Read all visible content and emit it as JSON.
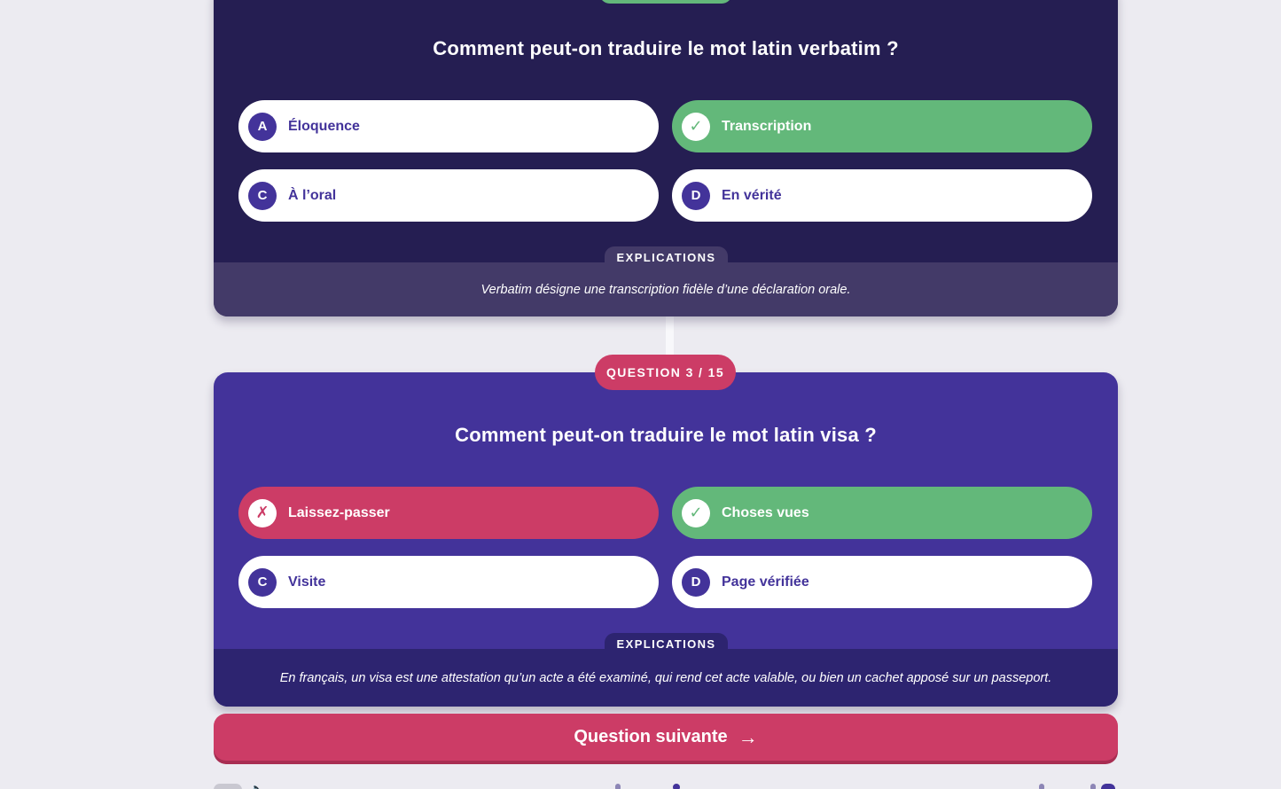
{
  "previous_question": {
    "question": "Comment peut-on traduire le mot latin verbatim ?",
    "answers": [
      {
        "badge": "A",
        "label": "Éloquence",
        "state": "neutral"
      },
      {
        "badge": "✓",
        "label": "Transcription",
        "state": "correct"
      },
      {
        "badge": "C",
        "label": "À l’oral",
        "state": "neutral"
      },
      {
        "badge": "D",
        "label": "En vérité",
        "state": "neutral"
      }
    ],
    "explanation_tab": "EXPLICATIONS",
    "explanation": "Verbatim désigne une transcription fidèle d’une déclaration orale."
  },
  "current_question": {
    "counter": "QUESTION 3 / 15",
    "question": "Comment peut-on traduire le mot latin visa ?",
    "answers": [
      {
        "badge": "✗",
        "label": "Laissez-passer",
        "state": "wrong"
      },
      {
        "badge": "✓",
        "label": "Choses vues",
        "state": "correct"
      },
      {
        "badge": "C",
        "label": "Visite",
        "state": "neutral"
      },
      {
        "badge": "D",
        "label": "Page vérifiée",
        "state": "neutral"
      }
    ],
    "explanation_tab": "EXPLICATIONS",
    "explanation": "En français, un visa est une attestation qu’un acte a été examiné, qui rend cet acte valable, ou bien un cachet apposé sur un passeport."
  },
  "next_button": {
    "label": "Question suivante",
    "arrow": "→"
  },
  "footer": {
    "speaker_icon": "🔈"
  },
  "colors": {
    "page_bg": "#ecebf1",
    "card_dark": "#251e52",
    "card_purple": "#43339a",
    "correct": "#63b87a",
    "wrong": "#cc3c66",
    "accent": "#cc3c66"
  }
}
